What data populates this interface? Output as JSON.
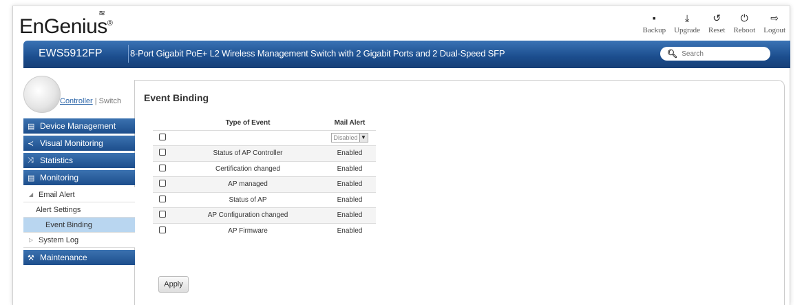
{
  "brand": {
    "logo": "EnGenius",
    "registered": "®"
  },
  "toolbar": {
    "items": [
      {
        "label": "Backup",
        "icon": "floppy-icon",
        "glyph": "▪"
      },
      {
        "label": "Upgrade",
        "icon": "upload-icon",
        "glyph": "⤓"
      },
      {
        "label": "Reset",
        "icon": "reset-icon",
        "glyph": "↺"
      },
      {
        "label": "Reboot",
        "icon": "power-icon",
        "glyph": "⏻"
      },
      {
        "label": "Logout",
        "icon": "logout-icon",
        "glyph": "⇨"
      }
    ]
  },
  "banner": {
    "model": "EWS5912FP",
    "description": "8-Port Gigabit PoE+ L2 Wireless Management Switch with 2 Gigabit Ports and 2 Dual-Speed SFP",
    "search_placeholder": "Search"
  },
  "mode": {
    "controller": "Controller",
    "separator": "|",
    "switch": "Switch"
  },
  "nav": {
    "device_management": "Device Management",
    "visual_monitoring": "Visual Monitoring",
    "statistics": "Statistics",
    "monitoring": "Monitoring",
    "email_alert": "Email Alert",
    "alert_settings": "Alert Settings",
    "event_binding": "Event Binding",
    "system_log": "System Log",
    "maintenance": "Maintenance"
  },
  "page": {
    "title": "Event Binding",
    "col_type": "Type of Event",
    "col_mail": "Mail Alert",
    "header_select": "Disabled",
    "rows": [
      {
        "event": "Status of AP Controller",
        "mail": "Enabled"
      },
      {
        "event": "Certification changed",
        "mail": "Enabled"
      },
      {
        "event": "AP managed",
        "mail": "Enabled"
      },
      {
        "event": "Status of AP",
        "mail": "Enabled"
      },
      {
        "event": "AP Configuration changed",
        "mail": "Enabled"
      },
      {
        "event": "AP Firmware",
        "mail": "Enabled"
      }
    ],
    "apply": "Apply"
  }
}
